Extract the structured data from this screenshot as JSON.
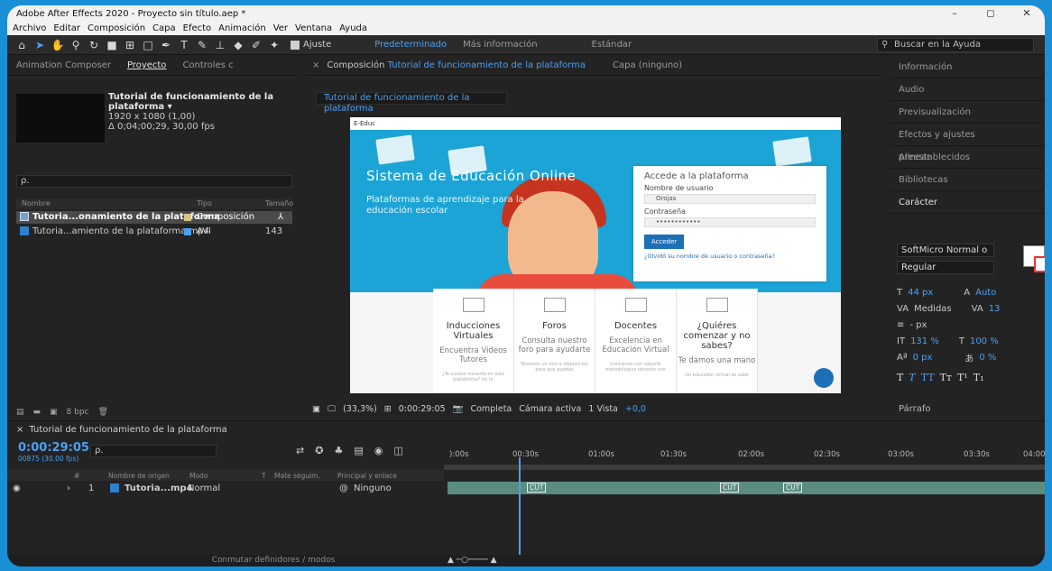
{
  "window": {
    "title": "Adobe After Effects 2020 - Proyecto sin título.aep *",
    "minimize": "–",
    "maximize": "◻",
    "close": "✕"
  },
  "menu": [
    "Archivo",
    "Editar",
    "Composición",
    "Capa",
    "Efecto",
    "Animación",
    "Ver",
    "Ventana",
    "Ayuda"
  ],
  "toolbar": {
    "snap_label": "Ajuste",
    "workspaces": [
      "Predeterminado",
      "Más información",
      "Estándar"
    ],
    "help_placeholder": "Buscar en la Ayuda"
  },
  "project_panel": {
    "tabs": [
      "Animation Composer",
      "Proyecto",
      "Controles c"
    ],
    "comp_name": "Tutorial de funcionamiento de la plataforma ▾",
    "comp_res": "1920 x 1080 (1,00)",
    "comp_duration": "Δ 0;04;00;29, 30,00 fps",
    "search_placeholder": "ρ.",
    "columns": [
      "Nombre",
      "Tipo",
      "Tamaño"
    ],
    "items": [
      {
        "name": "Tutoria...onamiento de la plataforma",
        "type": "Composición",
        "size": "",
        "color": "#d8c58c"
      },
      {
        "name": "Tutoria...amiento de la plataforma.mp4",
        "type": "AVI",
        "size": "143",
        "color": "#4d9ff0"
      }
    ],
    "bpc": "8 bpc"
  },
  "composition_panel": {
    "tab_prefix": "Composición",
    "tab_name": "Tutorial de funcionamiento de la plataforma",
    "layer_tab": "Capa (ninguno)",
    "breadcrumb": "Tutorial de funcionamiento de la plataforma",
    "footer": {
      "zoom": "(33,3%)",
      "timecode": "0:00:29:05",
      "resolution": "Completa",
      "camera": "Cámara activa",
      "views": "1 Vista",
      "exposure": "+0,0"
    }
  },
  "video_frame": {
    "brand": "E-Educ",
    "hero_title": "Sistema de Educación Online",
    "hero_subtitle": "Plataformas de aprendizaje para la educación escolar",
    "login_title": "Accede a la plataforma",
    "user_label": "Nombre de usuario",
    "user_value": "Orojas",
    "pass_label": "Contraseña",
    "pass_value": "••••••••••••",
    "login_button": "Acceder",
    "forgot": "¿Olvidó su nombre de usuario o contraseña?",
    "cards": [
      {
        "title": "Inducciones Virtuales",
        "subtitle": "Encuentra Videos Tutores",
        "small": "¿Te cuesta moverte en esta plataforma? no te"
      },
      {
        "title": "Foros",
        "subtitle": "Consulta nuestro foro para ayudarte",
        "small": "Tenemos un foro a disposición para que puedas"
      },
      {
        "title": "Docentes",
        "subtitle": "Excelencia en Educación Virtual",
        "small": "Contamos con soporte metodológico docente con"
      },
      {
        "title": "¿Quiéres comenzar y no sabes?",
        "subtitle": "Te damos una mano",
        "small": "Un educador virtual se sabe"
      }
    ]
  },
  "right_panel": {
    "items": [
      "Información",
      "Audio",
      "Previsualización",
      "Efectos y ajustes preestablecidos",
      "Alinear",
      "Bibliotecas",
      "Carácter"
    ],
    "font_family": "SoftMicro Normal o",
    "font_style": "Regular",
    "font_size": "44 px",
    "leading": "Auto",
    "kerning": "Medidas",
    "tracking": "13",
    "stroke_width": "- px",
    "vscale": "131 %",
    "hscale": "100 %",
    "baseline": "0 px",
    "tsume": "0 %",
    "paragraph": "Párrafo"
  },
  "timeline": {
    "comp_name": "Tutorial de funcionamiento de la plataforma",
    "time": "0:00:29:05",
    "frames": "00875 (30.00 fps)",
    "ruler": [
      "):00s",
      "00:30s",
      "01:00s",
      "01:30s",
      "02:00s",
      "02:30s",
      "03:00s",
      "03:30s",
      "04:00"
    ],
    "columns": [
      "#",
      "Nombre de origen",
      "Modo",
      "T",
      "Mate seguim.",
      "Principal y enlace"
    ],
    "layer": {
      "index": "1",
      "name": "Tutoria...mp4",
      "mode": "Normal",
      "parent": "Ninguno"
    },
    "cut_label": "CUT",
    "footer": "Conmutar definidores / modos"
  }
}
